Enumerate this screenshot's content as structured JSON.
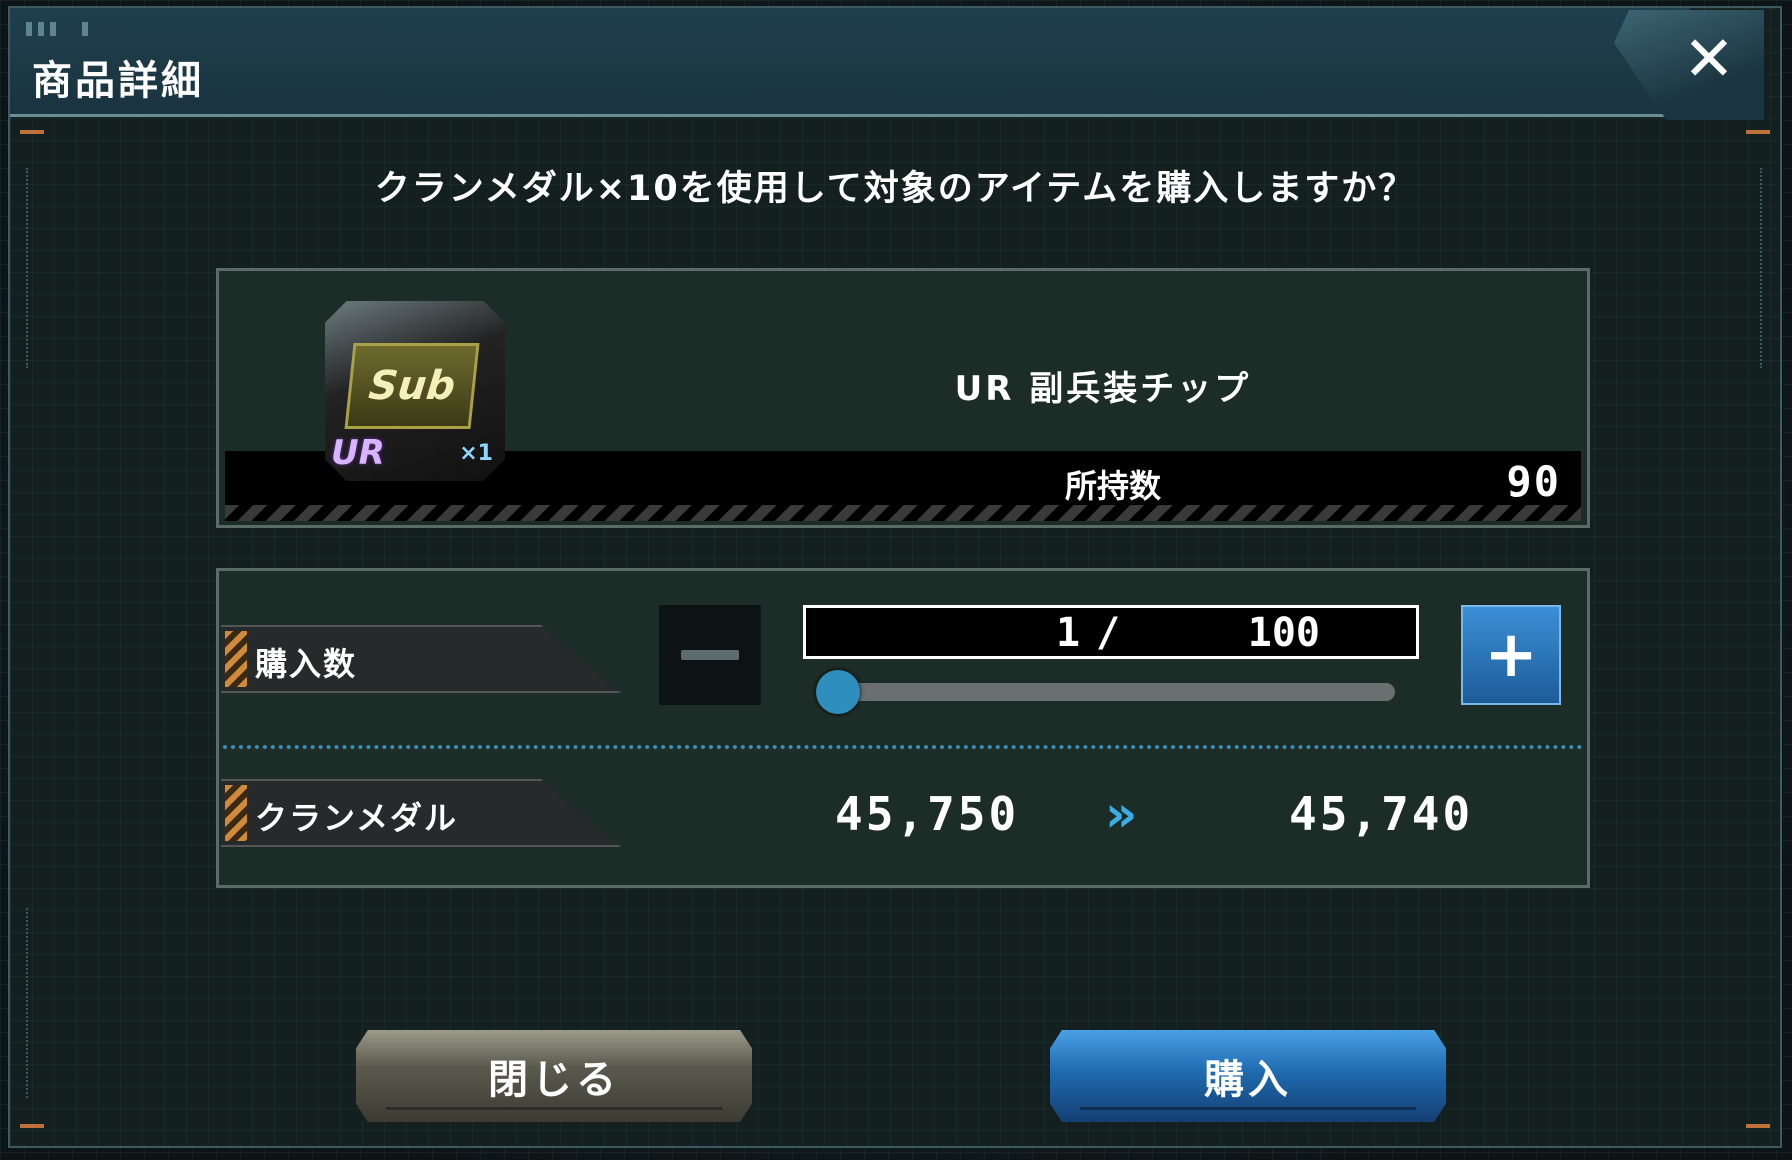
{
  "dialog": {
    "title": "商品詳細",
    "close_icon": "close-x-icon"
  },
  "question": "クランメダル×10を使用して対象のアイテムを購入しますか？",
  "item": {
    "icon_label": "Sub",
    "rarity": "UR",
    "icon_count": "×1",
    "name": "UR 副兵装チップ",
    "owned_label": "所持数",
    "owned_value": "90"
  },
  "quantity": {
    "label": "購入数",
    "current": "1",
    "separator": "/",
    "max": "100",
    "minus_icon": "minus-icon",
    "plus_symbol": "+",
    "slider_fraction": 0.01
  },
  "medal": {
    "label": "クランメダル",
    "from": "45,750",
    "arrow": "»",
    "to": "45,740"
  },
  "buttons": {
    "close_label": "閉じる",
    "buy_label": "購入"
  },
  "colors": {
    "accent_blue": "#2e8fbf",
    "stripe_orange": "#d08a3a",
    "panel_bg": "#1c2c27"
  }
}
